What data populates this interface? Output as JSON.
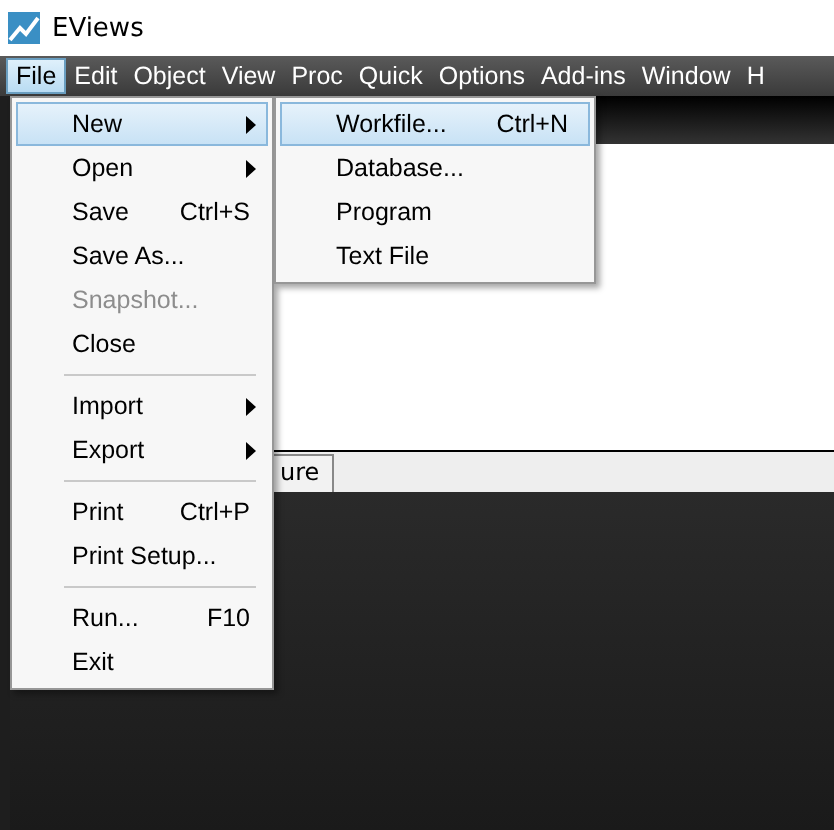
{
  "window": {
    "title": "EViews"
  },
  "menubar": [
    {
      "label": "File",
      "selected": true
    },
    {
      "label": "Edit",
      "selected": false
    },
    {
      "label": "Object",
      "selected": false
    },
    {
      "label": "View",
      "selected": false
    },
    {
      "label": "Proc",
      "selected": false
    },
    {
      "label": "Quick",
      "selected": false
    },
    {
      "label": "Options",
      "selected": false
    },
    {
      "label": "Add-ins",
      "selected": false
    },
    {
      "label": "Window",
      "selected": false
    },
    {
      "label": "H",
      "selected": false
    }
  ],
  "tab_strip": {
    "tabs": [
      {
        "label": "ure"
      }
    ]
  },
  "file_menu": [
    {
      "kind": "item",
      "label": "New",
      "submenu": true,
      "selected": true,
      "disabled": false
    },
    {
      "kind": "item",
      "label": "Open",
      "submenu": true,
      "selected": false,
      "disabled": false
    },
    {
      "kind": "item",
      "label": "Save",
      "shortcut": "Ctrl+S",
      "selected": false,
      "disabled": false
    },
    {
      "kind": "item",
      "label": "Save As...",
      "selected": false,
      "disabled": false
    },
    {
      "kind": "item",
      "label": "Snapshot...",
      "selected": false,
      "disabled": true
    },
    {
      "kind": "item",
      "label": "Close",
      "selected": false,
      "disabled": false
    },
    {
      "kind": "separator"
    },
    {
      "kind": "item",
      "label": "Import",
      "submenu": true,
      "selected": false,
      "disabled": false
    },
    {
      "kind": "item",
      "label": "Export",
      "submenu": true,
      "selected": false,
      "disabled": false
    },
    {
      "kind": "separator"
    },
    {
      "kind": "item",
      "label": "Print",
      "shortcut": "Ctrl+P",
      "selected": false,
      "disabled": false
    },
    {
      "kind": "item",
      "label": "Print Setup...",
      "selected": false,
      "disabled": false
    },
    {
      "kind": "separator"
    },
    {
      "kind": "item",
      "label": "Run...",
      "shortcut": "F10",
      "selected": false,
      "disabled": false
    },
    {
      "kind": "item",
      "label": "Exit",
      "selected": false,
      "disabled": false
    }
  ],
  "new_submenu": [
    {
      "kind": "item",
      "label": "Workfile...",
      "shortcut": "Ctrl+N",
      "selected": true,
      "disabled": false
    },
    {
      "kind": "item",
      "label": "Database...",
      "selected": false,
      "disabled": false
    },
    {
      "kind": "item",
      "label": "Program",
      "selected": false,
      "disabled": false
    },
    {
      "kind": "item",
      "label": "Text File",
      "selected": false,
      "disabled": false
    }
  ]
}
